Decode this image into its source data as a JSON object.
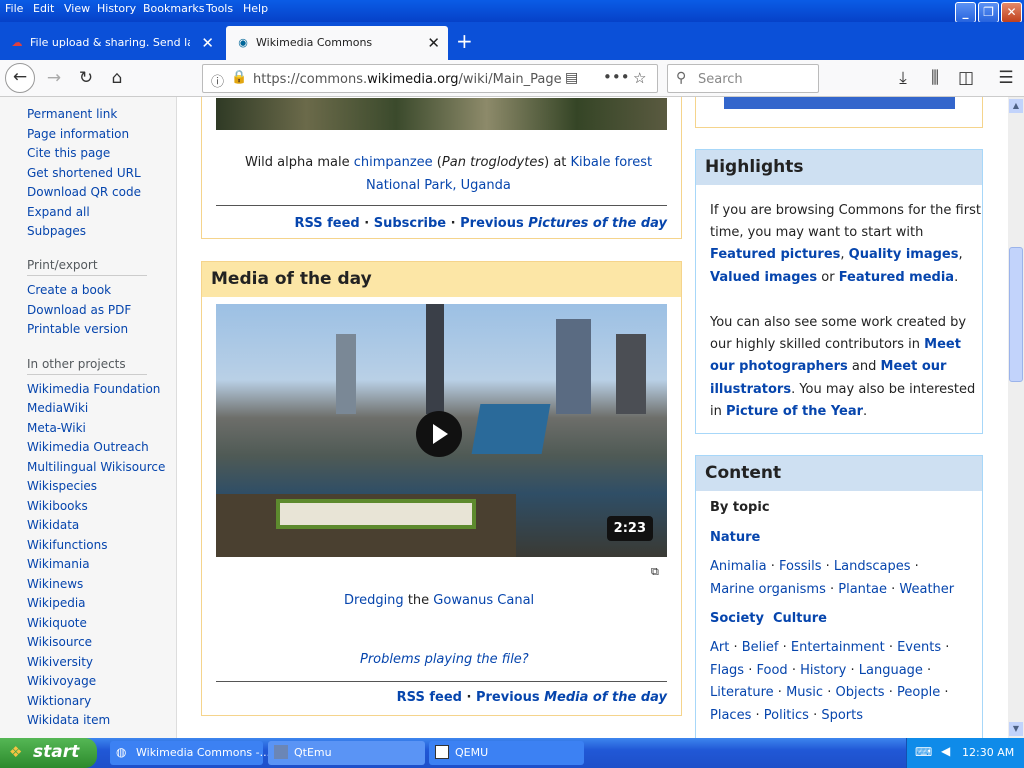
{
  "menubar": {
    "items": [
      "File",
      "Edit",
      "View",
      "History",
      "Bookmarks",
      "Tools",
      "Help"
    ]
  },
  "tabs": [
    {
      "label": "File upload & sharing. Send large f",
      "icon": "cloud-icon"
    },
    {
      "label": "Wikimedia Commons",
      "icon": "commons-icon"
    }
  ],
  "nav": {
    "url_prefix": "https://commons.",
    "url_domain": "wikimedia.org",
    "url_path": "/wiki/Main_Page",
    "search_placeholder": "Search"
  },
  "sidebar": {
    "top_links": [
      "Permanent link",
      "Page information",
      "Cite this page",
      "Get shortened URL",
      "Download QR code",
      "Expand all",
      "Subpages"
    ],
    "print_heading": "Print/export",
    "print_links": [
      "Create a book",
      "Download as PDF",
      "Printable version"
    ],
    "projects_heading": "In other projects",
    "projects_links": [
      "Wikimedia Foundation",
      "MediaWiki",
      "Meta-Wiki",
      "Wikimedia Outreach",
      "Multilingual Wikisource",
      "Wikispecies",
      "Wikibooks",
      "Wikidata",
      "Wikifunctions",
      "Wikimania",
      "Wikinews",
      "Wikipedia",
      "Wikiquote",
      "Wikisource",
      "Wikiversity",
      "Wikivoyage",
      "Wiktionary",
      "Wikidata item"
    ]
  },
  "potd": {
    "caption_1": "Wild alpha male ",
    "caption_link1": "chimpanzee",
    "caption_2": " (",
    "caption_italic": "Pan troglodytes",
    "caption_3": ") at ",
    "caption_link2": "Kibale forest",
    "caption_line2": "National Park, Uganda",
    "rss": "RSS feed",
    "sep": "·",
    "subscribe": "Subscribe",
    "previous": "Previous ",
    "previous_italic": "Pictures of the day"
  },
  "motd": {
    "heading": "Media of the day",
    "duration": "2:23",
    "caption_link1": "Dredging",
    "caption_mid": " the ",
    "caption_link2": "Gowanus Canal",
    "problems": "Problems playing the file?",
    "rss": "RSS feed",
    "sep": "·",
    "previous": "Previous ",
    "previous_italic": "Media of the day"
  },
  "highlights": {
    "heading": "Highlights",
    "l1": "If you are browsing Commons for the first",
    "l2": "time, you may want to start with",
    "fp": "Featured pictures",
    "qi": "Quality images",
    "vi": "Valued images",
    "or": " or ",
    "fm": "Featured media",
    "l5": "You can also see some work created by",
    "l6": "our highly skilled contributors in ",
    "mp1": "Meet",
    "mp2": "our photographers",
    "and": " and ",
    "mi1": "Meet our",
    "mi2": "illustrators",
    "l8": ". You may also be interested",
    "in": "in ",
    "poty": "Picture of the Year",
    "comma": ", ",
    "dot": "."
  },
  "content": {
    "heading": "Content",
    "by_topic": "By topic",
    "nature": "Nature",
    "nature_items": [
      "Animalia",
      "Fossils",
      "Landscapes",
      "Marine organisms",
      "Plantae",
      "Weather"
    ],
    "society": "Society  Culture",
    "society_items": [
      "Art",
      "Belief",
      "Entertainment",
      "Events",
      "Flags",
      "Food",
      "History",
      "Language",
      "Literature",
      "Music",
      "Objects",
      "People",
      "Places",
      "Politics",
      "Sports"
    ]
  },
  "taskbar": {
    "start": "start",
    "tasks": [
      "Wikimedia Commons -...",
      "QtEmu",
      "QEMU"
    ],
    "clock": "12:30 AM"
  },
  "colors": {
    "link": "#0645ad",
    "xp_blue": "#0b50d8",
    "gold_head": "#fce6a6",
    "blue_head": "#cee0f2"
  }
}
